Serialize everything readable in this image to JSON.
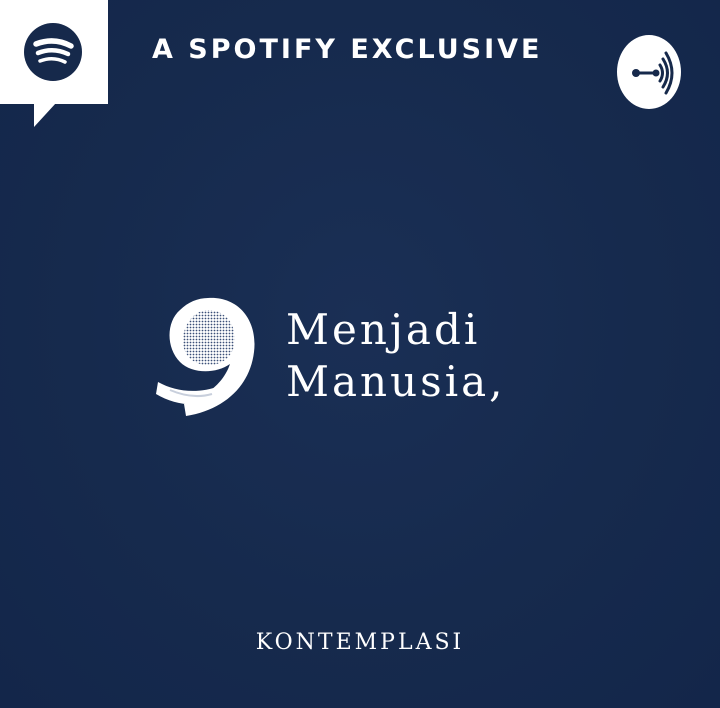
{
  "header": {
    "exclusive_label": "A SPOTIFY EXCLUSIVE",
    "left_icon": "spotify-icon",
    "right_icon": "anchor-icon"
  },
  "main": {
    "title_line1": "Menjadi",
    "title_line2": "Manusia,",
    "mark_icon": "quote-mark-icon"
  },
  "footer": {
    "label": "KONTEMPLASI"
  },
  "colors": {
    "background": "#16294b",
    "foreground": "#ffffff"
  }
}
